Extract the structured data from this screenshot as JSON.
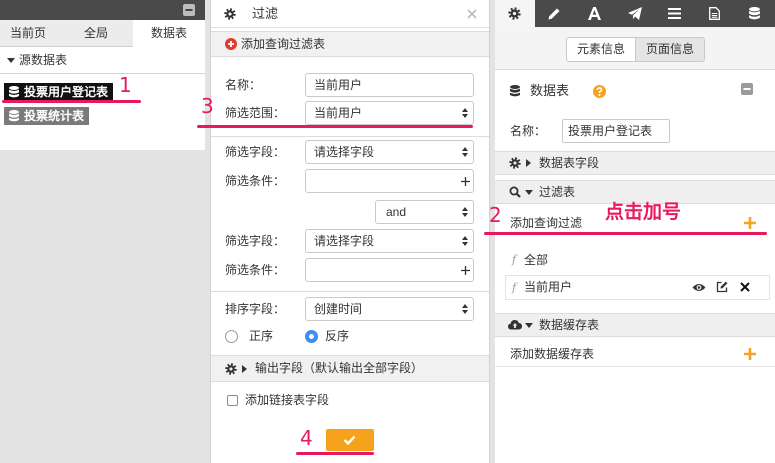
{
  "colors": {
    "annotation": "#e8195c",
    "accent_orange": "#f5a31d",
    "radio_blue": "#3b8df1",
    "dark_bar": "#4a4a4a",
    "delete_red": "#e5332a"
  },
  "left_panel": {
    "tabs": [
      {
        "label": "当前页",
        "active": false
      },
      {
        "label": "全局",
        "active": false
      },
      {
        "label": "数据表",
        "active": true
      }
    ],
    "section_title": "源数据表",
    "items": [
      {
        "label": "投票用户登记表",
        "selected": true,
        "icon": "database-icon"
      },
      {
        "label": "投票统计表",
        "selected": false,
        "icon": "database-icon"
      }
    ]
  },
  "filter_panel": {
    "title": "过滤",
    "add_filter_table": "添加查询过滤表",
    "name": {
      "label": "名称：",
      "value": "当前用户"
    },
    "scope": {
      "label": "筛选范围：",
      "value": "当前用户"
    },
    "conditions": [
      {
        "field_label": "筛选字段：",
        "field_value": "请选择字段",
        "condition_label": "筛选条件："
      },
      {
        "field_label": "筛选字段：",
        "field_value": "请选择字段",
        "condition_label": "筛选条件："
      }
    ],
    "connector": "and",
    "sort": {
      "label": "排序字段：",
      "value": "创建时间"
    },
    "order_options": [
      {
        "label": "正序",
        "checked": false
      },
      {
        "label": "反序",
        "checked": true
      }
    ],
    "output_fields": "输出字段（默认输出全部字段）",
    "link_fields": {
      "label": "添加链接表字段",
      "checked": false
    },
    "confirm_icon": "check-icon"
  },
  "right_panel": {
    "toolbar": [
      {
        "icon": "gear-icon",
        "active": true
      },
      {
        "icon": "pencil-icon",
        "active": false
      },
      {
        "icon": "font-icon",
        "active": false
      },
      {
        "icon": "send-icon",
        "active": false
      },
      {
        "icon": "list-icon",
        "active": false
      },
      {
        "icon": "file-icon",
        "active": false
      },
      {
        "icon": "database-icon",
        "active": false
      }
    ],
    "view_toggle": [
      {
        "label": "元素信息",
        "active": true
      },
      {
        "label": "页面信息",
        "active": false
      }
    ],
    "section_title": "数据表",
    "name": {
      "label": "名称：",
      "value": "投票用户登记表"
    },
    "fields_section": "数据表字段",
    "filter_section": "过滤表",
    "add_filter": "添加查询过滤",
    "filters": [
      {
        "prefix": "f",
        "label": "全部"
      },
      {
        "prefix": "f",
        "label": "当前用户"
      }
    ],
    "cache_section": "数据缓存表",
    "add_cache": "添加数据缓存表"
  },
  "annotations": {
    "steps": [
      "1",
      "2",
      "3",
      "4"
    ],
    "hint": "点击加号"
  }
}
